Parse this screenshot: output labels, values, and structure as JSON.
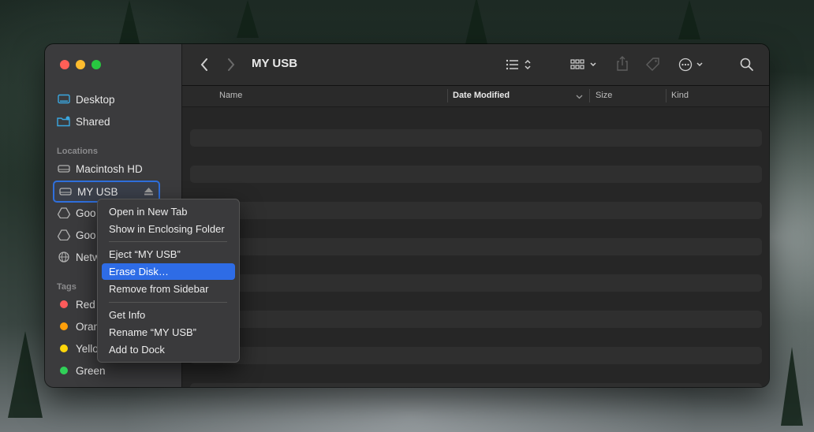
{
  "window": {
    "title": "MY USB"
  },
  "sidebar": {
    "favorites": [
      {
        "label": "Desktop",
        "icon": "desktop-icon"
      },
      {
        "label": "Shared",
        "icon": "shared-folder-icon"
      }
    ],
    "locations_header": "Locations",
    "locations": [
      {
        "label": "Macintosh HD",
        "icon": "drive-icon"
      },
      {
        "label": "MY USB",
        "icon": "drive-icon",
        "selected": true
      },
      {
        "label": "Goo",
        "icon": "google-drive-icon"
      },
      {
        "label": "Goo",
        "icon": "google-drive-icon"
      },
      {
        "label": "Netw",
        "icon": "network-icon"
      }
    ],
    "tags_header": "Tags",
    "tags": [
      {
        "label": "Red",
        "color": "#ff5b5b"
      },
      {
        "label": "Oran",
        "color": "#ff9f0a"
      },
      {
        "label": "Yello",
        "color": "#ffd60a"
      },
      {
        "label": "Green",
        "color": "#30d158"
      }
    ]
  },
  "columns": {
    "name": "Name",
    "date_modified": "Date Modified",
    "size": "Size",
    "kind": "Kind"
  },
  "context_menu": {
    "items": [
      {
        "label": "Open in New Tab"
      },
      {
        "label": "Show in Enclosing Folder"
      },
      {
        "label": "Eject “MY USB”"
      },
      {
        "label": "Erase Disk…",
        "highlighted": true
      },
      {
        "label": "Remove from Sidebar"
      },
      {
        "label": "Get Info"
      },
      {
        "label": "Rename “MY USB”"
      },
      {
        "label": "Add to Dock"
      }
    ]
  },
  "colors": {
    "accent": "#2e6ce6",
    "close": "#ff5f57",
    "minimize": "#febc2e",
    "maximize": "#28c840"
  }
}
